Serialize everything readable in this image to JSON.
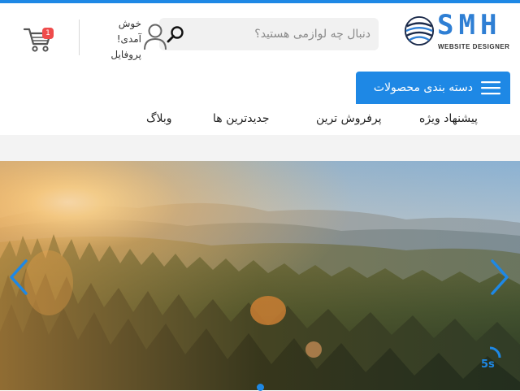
{
  "brand": {
    "name": "SMH",
    "tagline": "WEBSITE DESIGNER"
  },
  "search": {
    "placeholder": "دنبال چه لوازمی هستید؟"
  },
  "profile": {
    "line1": "خوش",
    "line2": "آمدی!",
    "line3": "پروفایل"
  },
  "cart": {
    "count": "1"
  },
  "categories": {
    "label": "دسته بندی محصولات"
  },
  "nav": {
    "items": [
      "پیشنهاد ویژه",
      "پرفروش ترین",
      "جدیدترین ها",
      "وبلاگ"
    ]
  },
  "slider": {
    "timer": "5s",
    "active_slide": 1
  },
  "colors": {
    "accent": "#1e88e5",
    "badge": "#ef4b4b"
  },
  "icons": [
    "search-icon",
    "user-icon",
    "cart-icon",
    "hamburger-icon",
    "chevron-left-icon",
    "chevron-right-icon",
    "globe-logo-icon"
  ]
}
